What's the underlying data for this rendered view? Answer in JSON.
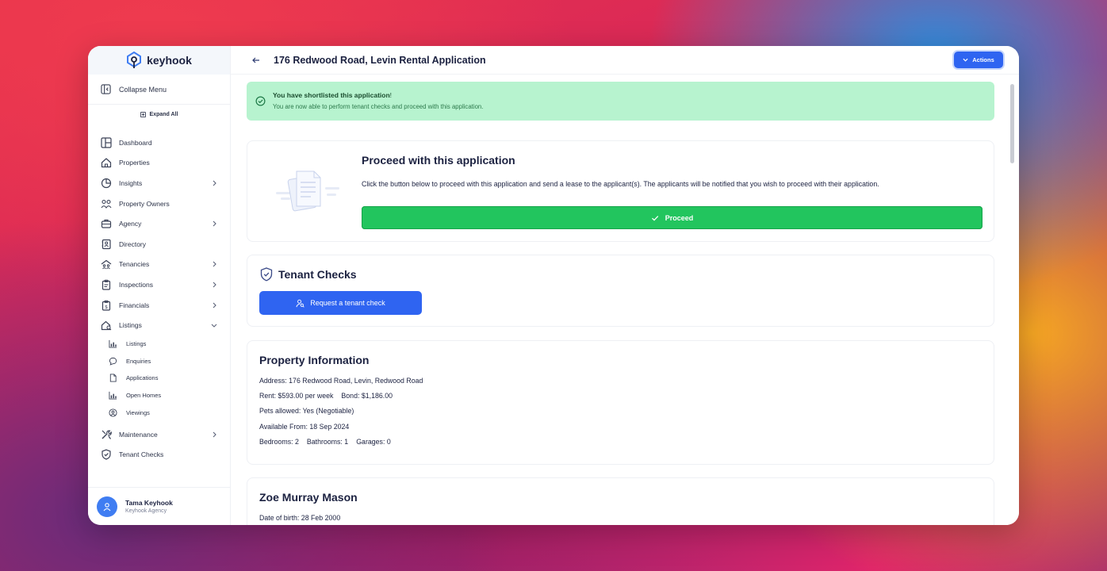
{
  "brand": {
    "name": "keyhook"
  },
  "sidebar": {
    "collapse_label": "Collapse Menu",
    "expand_label": "Expand All",
    "items": [
      {
        "label": "Dashboard",
        "icon": "layout-icon",
        "chevron": false
      },
      {
        "label": "Properties",
        "icon": "home-icon",
        "chevron": false
      },
      {
        "label": "Insights",
        "icon": "pie-chart-icon",
        "chevron": true
      },
      {
        "label": "Property Owners",
        "icon": "users-icon",
        "chevron": false
      },
      {
        "label": "Agency",
        "icon": "briefcase-icon",
        "chevron": true
      },
      {
        "label": "Directory",
        "icon": "address-book-icon",
        "chevron": false
      },
      {
        "label": "Tenancies",
        "icon": "group-home-icon",
        "chevron": true
      },
      {
        "label": "Inspections",
        "icon": "clipboard-icon",
        "chevron": true
      },
      {
        "label": "Financials",
        "icon": "dollar-clipboard-icon",
        "chevron": true
      },
      {
        "label": "Listings",
        "icon": "home-search-icon",
        "chevron": "down"
      }
    ],
    "sub_items": [
      {
        "label": "Listings",
        "icon": "chart-icon"
      },
      {
        "label": "Enquiries",
        "icon": "chat-icon"
      },
      {
        "label": "Applications",
        "icon": "file-icon"
      },
      {
        "label": "Open Homes",
        "icon": "chart-icon"
      },
      {
        "label": "Viewings",
        "icon": "user-circle-icon"
      }
    ],
    "bottom_items": [
      {
        "label": "Maintenance",
        "icon": "tools-icon",
        "chevron": true
      },
      {
        "label": "Tenant Checks",
        "icon": "shield-check-icon",
        "chevron": false
      }
    ],
    "user": {
      "name": "Tama Keyhook",
      "org": "Keyhook Agency"
    }
  },
  "header": {
    "title": "176 Redwood Road, Levin Rental Application",
    "actions_label": "Actions"
  },
  "alert": {
    "title": "You have shortlisted this application",
    "exclaim": "!",
    "message": "You are now able to perform tenant checks and proceed with this application."
  },
  "proceed": {
    "title": "Proceed with this application",
    "description": "Click the button below to proceed with this application and send a lease to the applicant(s). The applicants will be notified that you wish to proceed with their application.",
    "button_label": "Proceed"
  },
  "tenant_checks": {
    "title": "Tenant Checks",
    "button_label": "Request a tenant check"
  },
  "property_info": {
    "title": "Property Information",
    "address": "Address: 176 Redwood Road, Levin, Redwood Road",
    "rent": "Rent: $593.00 per week",
    "bond": "Bond: $1,186.00",
    "pets": "Pets allowed: Yes  (Negotiable)",
    "available": "Available From: 18 Sep 2024",
    "bedrooms": "Bedrooms: 2",
    "bathrooms": "Bathrooms: 1",
    "garages": "Garages: 0"
  },
  "applicant": {
    "name": "Zoe Murray Mason",
    "dob": "Date of birth: 28 Feb 2000"
  }
}
